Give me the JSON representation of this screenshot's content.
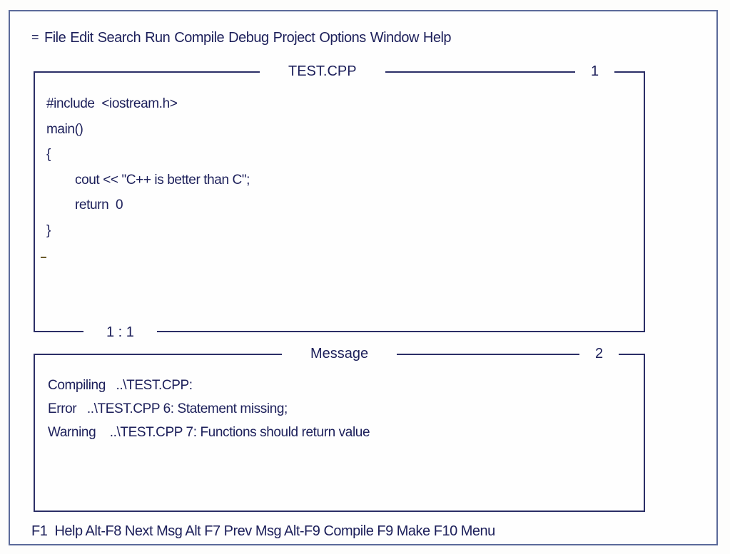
{
  "menubar": {
    "system_glyph": "=",
    "items": [
      "File",
      "Edit",
      "Search",
      "Run",
      "Compile",
      "Debug",
      "Project",
      "Options",
      "Window",
      "Help"
    ]
  },
  "editor": {
    "title": "TEST.CPP",
    "window_number": "1",
    "cursor_position": "1 : 1",
    "lines": [
      {
        "text": "#include  <iostream.h>",
        "indent": false
      },
      {
        "text": "main()",
        "indent": false
      },
      {
        "text": "{",
        "indent": false
      },
      {
        "text": "cout << \"C++ is better than C\";",
        "indent": true
      },
      {
        "text": "return  0",
        "indent": true
      },
      {
        "text": "}",
        "indent": false
      }
    ]
  },
  "message": {
    "title": "Message",
    "window_number": "2",
    "lines": [
      "Compiling   ..\\TEST.CPP:",
      "Error   ..\\TEST.CPP 6: Statement missing;",
      "Warning    ..\\TEST.CPP 7: Functions should return value"
    ]
  },
  "statusbar": {
    "text": "F1  Help Alt-F8 Next Msg Alt F7 Prev Msg Alt-F9 Compile F9 Make F10 Menu"
  }
}
